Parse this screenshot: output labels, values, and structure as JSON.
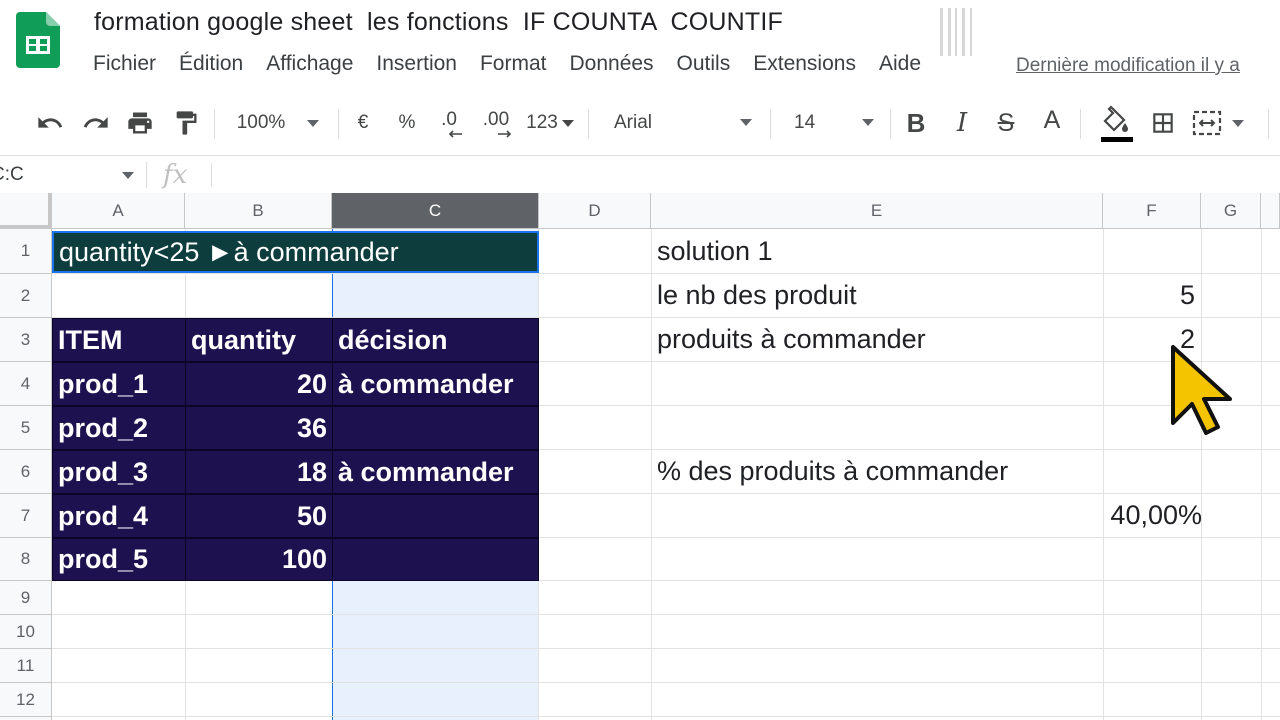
{
  "app": {
    "doc_title": "formation google sheet  les fonctions  IF COUNTA  COUNTIF",
    "last_edit": "Dernière modification il y a",
    "menus": [
      "Fichier",
      "Édition",
      "Affichage",
      "Insertion",
      "Format",
      "Données",
      "Outils",
      "Extensions",
      "Aide"
    ]
  },
  "toolbar": {
    "zoom": "100%",
    "currency": "€",
    "percent": "%",
    "dec_decrease": ".0",
    "dec_increase": ".00",
    "number_format": "123",
    "font": "Arial",
    "font_size": "14",
    "bold": "B",
    "italic": "I",
    "strike": "S",
    "text_color": "A"
  },
  "formula_bar": {
    "name_box": "C:C",
    "fx": "fx",
    "formula": ""
  },
  "sheet": {
    "columns": [
      "A",
      "B",
      "C",
      "D",
      "E",
      "F",
      "G"
    ],
    "rows": [
      "1",
      "2",
      "3",
      "4",
      "5",
      "6",
      "7",
      "8",
      "9",
      "10",
      "11",
      "12"
    ],
    "selected_column": "C",
    "banner": "quantity<25  ►à commander",
    "table": {
      "headers": [
        "ITEM",
        "quantity",
        "décision"
      ],
      "rows": [
        {
          "item": "prod_1",
          "quantity": "20",
          "decision": "à commander"
        },
        {
          "item": "prod_2",
          "quantity": "36",
          "decision": ""
        },
        {
          "item": "prod_3",
          "quantity": "18",
          "decision": "à commander"
        },
        {
          "item": "prod_4",
          "quantity": "50",
          "decision": ""
        },
        {
          "item": "prod_5",
          "quantity": "100",
          "decision": ""
        }
      ]
    },
    "side": {
      "solution": "solution 1",
      "nb_label": "le nb des produit",
      "nb_value": "5",
      "order_label": "produits à commander",
      "order_value": "2",
      "pct_label": "% des produits à commander",
      "pct_value": "40,00%"
    }
  },
  "colors": {
    "table_fill": "#1e1150",
    "banner_fill": "#0d3d3d",
    "selected_column_fill": "#e8f0fe",
    "cursor": "#f5c400"
  }
}
